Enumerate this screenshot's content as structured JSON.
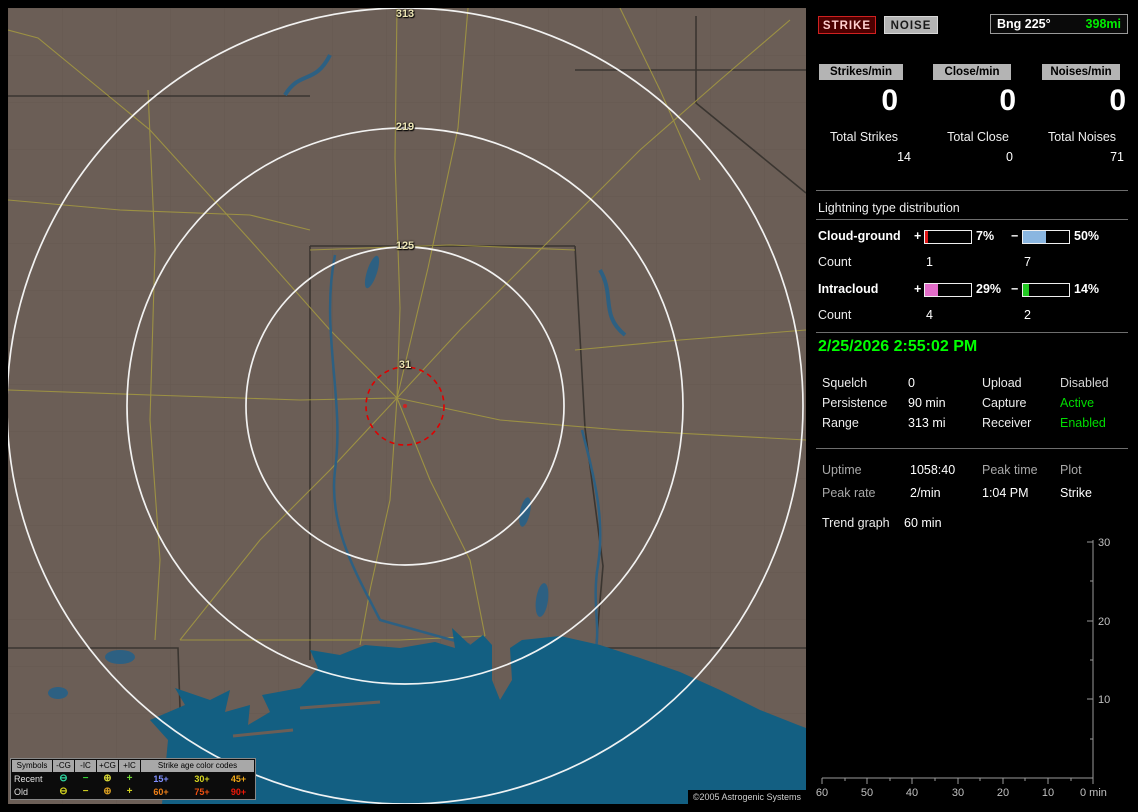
{
  "panel": {
    "strike_button": "STRIKE",
    "noise_button": "NOISE",
    "bearing_label": "Bng 225°",
    "bearing_value": "398mi",
    "counters": [
      {
        "header": "Strikes/min",
        "rate": "0",
        "total_label": "Total Strikes",
        "total_value": "14"
      },
      {
        "header": "Close/min",
        "rate": "0",
        "total_label": "Total Close",
        "total_value": "0"
      },
      {
        "header": "Noises/min",
        "rate": "0",
        "total_label": "Total Noises",
        "total_value": "71"
      }
    ],
    "distribution": {
      "title": "Lightning type distribution",
      "plus": "+",
      "minus": "−",
      "rows": [
        {
          "label": "Cloud-ground",
          "plus_pct": "7%",
          "plus_fill": 7,
          "plus_color": "#e01818",
          "minus_pct": "50%",
          "minus_fill": 50,
          "minus_color": "#8ab6e0",
          "count_label": "Count",
          "plus_count": "1",
          "minus_count": "7"
        },
        {
          "label": "Intracloud",
          "plus_pct": "29%",
          "plus_fill": 29,
          "plus_color": "#e26cc8",
          "minus_pct": "14%",
          "minus_fill": 14,
          "minus_color": "#22c822",
          "count_label": "Count",
          "plus_count": "4",
          "minus_count": "2"
        }
      ]
    },
    "timestamp": "2/25/2026 2:55:02 PM",
    "settings": [
      {
        "l1": "Squelch",
        "v1": "0",
        "l2": "Upload",
        "v2": "Disabled",
        "v2_color": "#d6d6d6"
      },
      {
        "l1": "Persistence",
        "v1": "90 min",
        "l2": "Capture",
        "v2": "Active",
        "v2_color": "#00dd00"
      },
      {
        "l1": "Range",
        "v1": "313 mi",
        "l2": "Receiver",
        "v2": "Enabled",
        "v2_color": "#00dd00"
      }
    ],
    "stats": [
      {
        "l1": "Uptime",
        "v1": "1058:40",
        "l2": "Peak time",
        "l3": "Plot"
      },
      {
        "l1": "Peak rate",
        "v1": "2/min",
        "v2": "1:04 PM",
        "v3": "Strike"
      }
    ],
    "trend_label": "Trend graph",
    "trend_value": "60 min",
    "trend": {
      "y_ticks": [
        "30",
        "20",
        "10"
      ],
      "x_ticks": [
        "60",
        "50",
        "40",
        "30",
        "20",
        "10"
      ],
      "x_end": "0 min",
      "y_range": [
        0,
        30
      ],
      "x_range_min": [
        60,
        0
      ]
    }
  },
  "map": {
    "ring_labels": [
      "313",
      "219",
      "125",
      "31"
    ],
    "copyright": "©2005 Astrogenic Systems",
    "legend": {
      "col_headers": [
        "Symbols",
        "-CG",
        "-IC",
        "+CG",
        "+IC"
      ],
      "age_header": "Strike age color codes",
      "rows": [
        {
          "label": "Recent",
          "symbols": [
            {
              "ch": "⊖",
              "color": "#2fd6a0"
            },
            {
              "ch": "−",
              "color": "#35d435"
            },
            {
              "ch": "⊕",
              "color": "#d4d435"
            },
            {
              "ch": "+",
              "color": "#6fd435"
            }
          ],
          "ages": [
            {
              "t": "15+",
              "color": "#7f8fff"
            },
            {
              "t": "30+",
              "color": "#d8d820"
            },
            {
              "t": "45+",
              "color": "#f0a818"
            }
          ]
        },
        {
          "label": "Old",
          "symbols": [
            {
              "ch": "⊖",
              "color": "#cfcf20"
            },
            {
              "ch": "−",
              "color": "#cfcf20"
            },
            {
              "ch": "⊕",
              "color": "#d49a20"
            },
            {
              "ch": "+",
              "color": "#cfcf20"
            }
          ],
          "ages": [
            {
              "t": "60+",
              "color": "#f08018"
            },
            {
              "t": "75+",
              "color": "#f05010"
            },
            {
              "t": "90+",
              "color": "#f01808"
            }
          ]
        }
      ]
    }
  }
}
